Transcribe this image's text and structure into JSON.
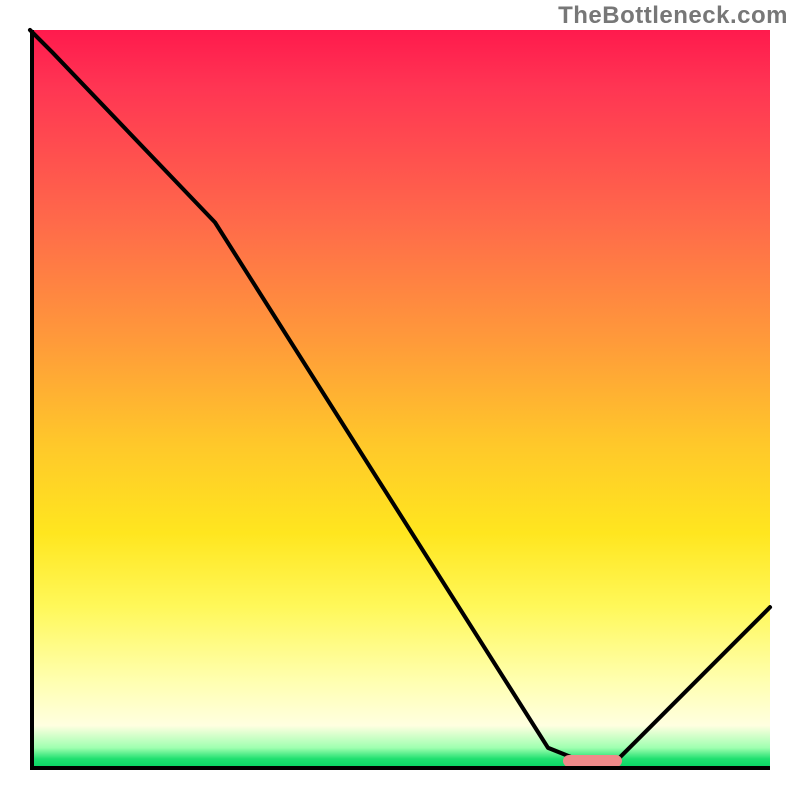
{
  "watermark": "TheBottleneck.com",
  "chart_data": {
    "type": "line",
    "title": "",
    "xlabel": "",
    "ylabel": "",
    "xlim": [
      0,
      100
    ],
    "ylim": [
      0,
      100
    ],
    "series": [
      {
        "name": "curve",
        "x": [
          0,
          3,
          25,
          70,
          75,
          79,
          100
        ],
        "values": [
          100,
          97,
          74,
          3,
          1,
          1,
          22
        ]
      }
    ],
    "annotations": [
      {
        "name": "marker",
        "x_start": 72,
        "x_end": 80,
        "y": 1.2
      }
    ],
    "background": "vertical-gradient red→yellow→green"
  }
}
